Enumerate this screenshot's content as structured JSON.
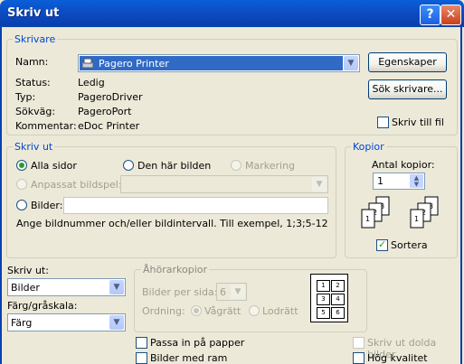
{
  "window": {
    "title": "Skriv ut"
  },
  "printer": {
    "legend": "Skrivare",
    "name_label": "Namn:",
    "name_value": "Pagero Printer",
    "status_label": "Status:",
    "status_value": "Ledig",
    "type_label": "Typ:",
    "type_value": "PageroDriver",
    "path_label": "Sökväg:",
    "path_value": "PageroPort",
    "comment_label": "Kommentar:",
    "comment_value": "eDoc Printer",
    "properties_button": "Egenskaper",
    "find_button": "Sök skrivare...",
    "print_to_file": "Skriv till fil"
  },
  "range": {
    "legend": "Skriv ut",
    "all_pages": "Alla sidor",
    "this_image": "Den här bilden",
    "selection": "Markering",
    "custom_show": "Anpassat bildspel:",
    "slides": "Bilder:",
    "hint": "Ange bildnummer och/eller bildintervall. Till exempel, 1;3;5-12"
  },
  "copies": {
    "legend": "Kopior",
    "count_label": "Antal kopior:",
    "count_value": "1",
    "collate": "Sortera"
  },
  "print_what": {
    "label": "Skriv ut:",
    "value": "Bilder"
  },
  "color": {
    "label": "Färg/gråskala:",
    "value": "Färg"
  },
  "handouts": {
    "legend": "Åhörarkopior",
    "per_page_label": "Bilder per sida:",
    "per_page_value": "6",
    "order_label": "Ordning:",
    "horizontal": "Vågrätt",
    "vertical": "Lodrätt",
    "preview_numbers": [
      "1",
      "2",
      "3",
      "4",
      "5",
      "6"
    ]
  },
  "options": {
    "fit_to_paper": "Passa in på papper",
    "frame_slides": "Bilder med ram",
    "print_hidden": "Skriv ut dolda bilder",
    "high_quality": "Hög kvalitet"
  }
}
